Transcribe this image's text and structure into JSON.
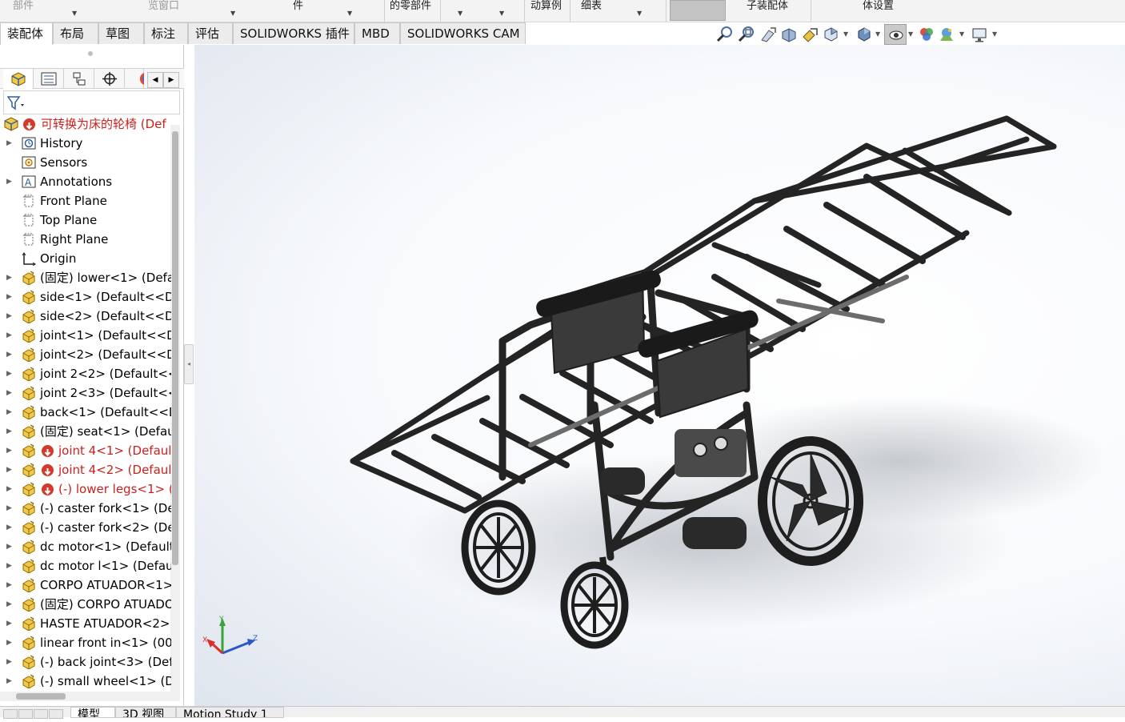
{
  "ribbon": {
    "groups": [
      {
        "label": "部件",
        "dim": true
      },
      {
        "label": "览窗口",
        "dim": true
      },
      {
        "label": "件",
        "dim": false
      },
      {
        "label": "的零部件",
        "dim": false
      },
      {
        "label": "动算例",
        "dim": false
      },
      {
        "label": "细表",
        "dim": false
      },
      {
        "label": "子装配体",
        "dim": false
      },
      {
        "label": "体设置",
        "dim": false
      }
    ]
  },
  "tabs": [
    {
      "label": "装配体",
      "active": true
    },
    {
      "label": "布局",
      "active": false
    },
    {
      "label": "草图",
      "active": false
    },
    {
      "label": "标注",
      "active": false
    },
    {
      "label": "评估",
      "active": false
    },
    {
      "label": "SOLIDWORKS 插件",
      "active": false
    },
    {
      "label": "MBD",
      "active": false
    },
    {
      "label": "SOLIDWORKS CAM",
      "active": false
    }
  ],
  "view_toolbar": {
    "icons": [
      "zoom-to-fit-icon",
      "zoom-to-area-icon",
      "previous-view-icon",
      "section-view-icon",
      "dynamic-annotation-icon",
      "view-orientation-icon",
      "display-style-icon",
      "hide-show-items-icon",
      "edit-appearance-icon",
      "apply-scene-icon",
      "view-settings-icon"
    ]
  },
  "feature_tree": {
    "root": "可转换为床的轮椅  (Def",
    "items": [
      {
        "label": "History",
        "icon": "history-icon",
        "expandable": true,
        "state": "normal"
      },
      {
        "label": "Sensors",
        "icon": "sensors-icon",
        "expandable": false,
        "state": "normal"
      },
      {
        "label": "Annotations",
        "icon": "annotations-icon",
        "expandable": true,
        "state": "normal"
      },
      {
        "label": "Front Plane",
        "icon": "plane-icon",
        "expandable": false,
        "state": "normal"
      },
      {
        "label": "Top Plane",
        "icon": "plane-icon",
        "expandable": false,
        "state": "normal"
      },
      {
        "label": "Right Plane",
        "icon": "plane-icon",
        "expandable": false,
        "state": "normal"
      },
      {
        "label": "Origin",
        "icon": "origin-icon",
        "expandable": false,
        "state": "normal"
      },
      {
        "label": "(固定) lower<1> (Defa",
        "icon": "part-icon",
        "expandable": true,
        "state": "normal"
      },
      {
        "label": "side<1> (Default<<De",
        "icon": "part-icon",
        "expandable": true,
        "state": "normal"
      },
      {
        "label": "side<2> (Default<<De",
        "icon": "part-icon",
        "expandable": true,
        "state": "normal"
      },
      {
        "label": "joint<1> (Default<<D",
        "icon": "part-icon",
        "expandable": true,
        "state": "normal"
      },
      {
        "label": "joint<2> (Default<<D",
        "icon": "part-icon",
        "expandable": true,
        "state": "normal"
      },
      {
        "label": "joint 2<2> (Default<<",
        "icon": "part-icon",
        "expandable": true,
        "state": "normal"
      },
      {
        "label": "joint 2<3> (Default<<",
        "icon": "part-icon",
        "expandable": true,
        "state": "normal"
      },
      {
        "label": "back<1> (Default<<D",
        "icon": "part-icon",
        "expandable": true,
        "state": "normal"
      },
      {
        "label": "(固定) seat<1> (Defaul",
        "icon": "part-icon",
        "expandable": true,
        "state": "normal"
      },
      {
        "label": "joint 4<1> (Default",
        "icon": "part-icon",
        "expandable": true,
        "state": "error"
      },
      {
        "label": "joint 4<2> (Default",
        "icon": "part-icon",
        "expandable": true,
        "state": "error"
      },
      {
        "label": "(-) lower legs<1> (",
        "icon": "part-icon",
        "expandable": true,
        "state": "error"
      },
      {
        "label": "(-) caster fork<1> (De",
        "icon": "part-icon",
        "expandable": true,
        "state": "normal"
      },
      {
        "label": "(-) caster fork<2> (De",
        "icon": "part-icon",
        "expandable": true,
        "state": "normal"
      },
      {
        "label": "dc motor<1> (Default",
        "icon": "part-icon",
        "expandable": true,
        "state": "normal"
      },
      {
        "label": "dc motor l<1> (Defau",
        "icon": "part-icon",
        "expandable": true,
        "state": "normal"
      },
      {
        "label": "CORPO ATUADOR<1>",
        "icon": "part-icon",
        "expandable": true,
        "state": "normal"
      },
      {
        "label": "(固定) CORPO ATUADO",
        "icon": "part-icon",
        "expandable": true,
        "state": "normal"
      },
      {
        "label": "HASTE ATUADOR<2>",
        "icon": "part-icon",
        "expandable": true,
        "state": "normal"
      },
      {
        "label": "linear front in<1> (00",
        "icon": "part-icon",
        "expandable": true,
        "state": "normal"
      },
      {
        "label": "(-) back joint<3> (Def",
        "icon": "part-icon",
        "expandable": true,
        "state": "normal"
      },
      {
        "label": "(-) small wheel<1> (De",
        "icon": "part-icon",
        "expandable": true,
        "state": "normal"
      }
    ]
  },
  "bottom_tabs": [
    {
      "label": "模型",
      "active": true
    },
    {
      "label": "3D 视图",
      "active": false
    },
    {
      "label": "Motion Study 1",
      "active": false
    }
  ],
  "triad": {
    "x": "X",
    "y": "Y",
    "z": "Z"
  },
  "colors": {
    "error": "#c9211e",
    "x_axis": "#d9302a",
    "y_axis": "#3aa33a",
    "z_axis": "#2b57c9",
    "frame": "#2a2a2a"
  }
}
